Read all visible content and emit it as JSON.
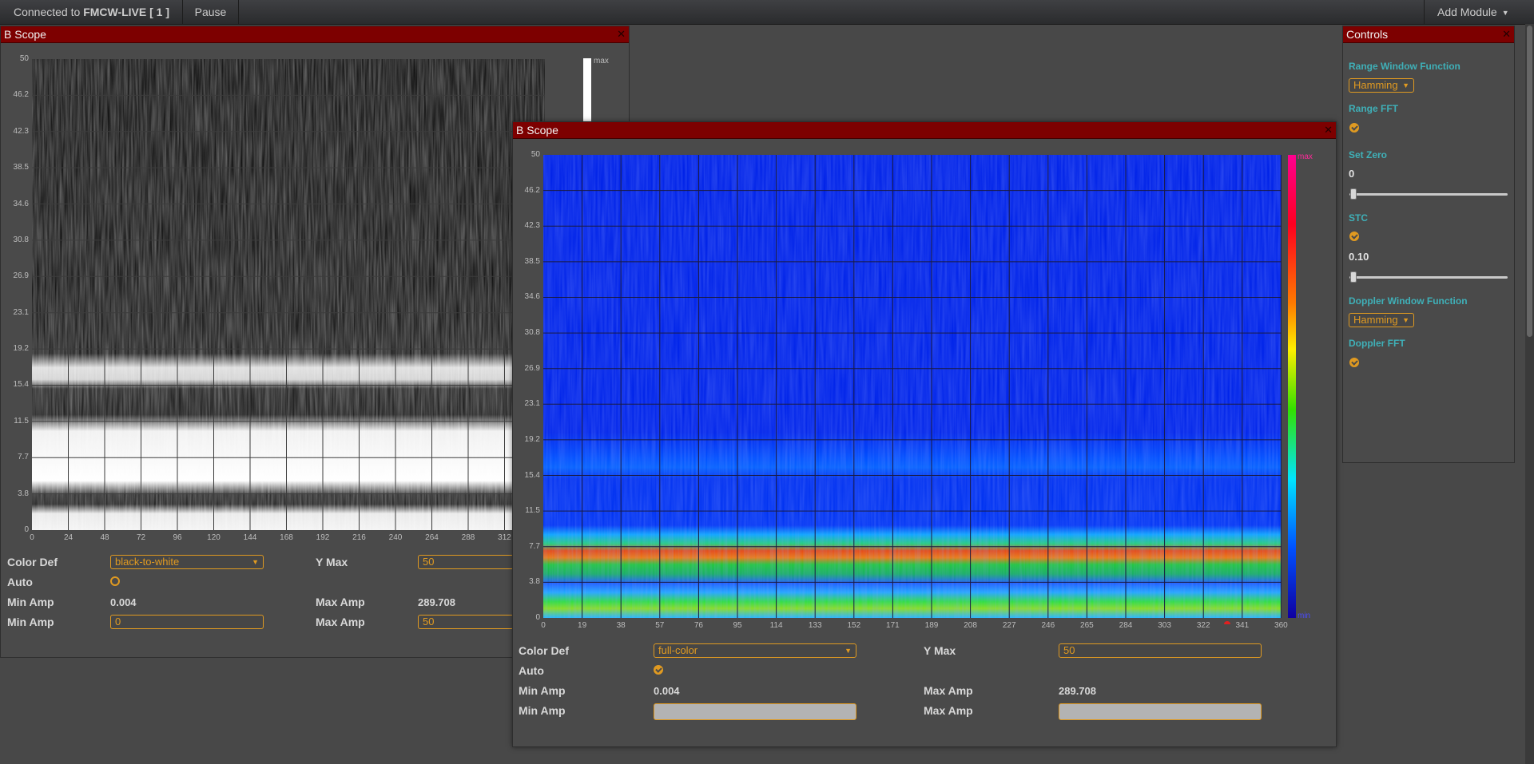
{
  "navbar": {
    "connected_prefix": "Connected to",
    "connected_name": "FMCW-LIVE [ 1 ]",
    "pause_label": "Pause",
    "add_module_label": "Add Module"
  },
  "scope1": {
    "title": "B Scope",
    "y_ticks": [
      "50",
      "46.2",
      "42.3",
      "38.5",
      "34.6",
      "30.8",
      "26.9",
      "23.1",
      "19.2",
      "15.4",
      "11.5",
      "7.7",
      "3.8",
      "0"
    ],
    "x_ticks": [
      "0",
      "24",
      "48",
      "72",
      "96",
      "120",
      "144",
      "168",
      "192",
      "216",
      "240",
      "264",
      "288",
      "312"
    ],
    "colorbar_max": "max",
    "color_def_label": "Color Def",
    "color_def_value": "black-to-white",
    "y_max_label": "Y Max",
    "y_max_value": "50",
    "auto_label": "Auto",
    "min_amp_label": "Min Amp",
    "min_amp_value": "0.004",
    "max_amp_label": "Max Amp",
    "max_amp_value": "289.708",
    "min_amp_input": "0",
    "max_amp_input": "50"
  },
  "scope2": {
    "title": "B Scope",
    "y_ticks": [
      "50",
      "46.2",
      "42.3",
      "38.5",
      "34.6",
      "30.8",
      "26.9",
      "23.1",
      "19.2",
      "15.4",
      "11.5",
      "7.7",
      "3.8",
      "0"
    ],
    "x_ticks": [
      "0",
      "19",
      "38",
      "57",
      "76",
      "95",
      "114",
      "133",
      "152",
      "171",
      "189",
      "208",
      "227",
      "246",
      "265",
      "284",
      "303",
      "322",
      "341",
      "360"
    ],
    "colorbar_max": "max",
    "colorbar_min": "min",
    "color_def_label": "Color Def",
    "color_def_value": "full-color",
    "y_max_label": "Y Max",
    "y_max_value": "50",
    "auto_label": "Auto",
    "min_amp_label": "Min Amp",
    "min_amp_value": "0.004",
    "max_amp_label": "Max Amp",
    "max_amp_value": "289.708",
    "min_amp2_label": "Min Amp",
    "max_amp2_label": "Max Amp"
  },
  "controls": {
    "title": "Controls",
    "range_window_label": "Range Window Function",
    "range_window_value": "Hamming",
    "range_fft_label": "Range FFT",
    "set_zero_label": "Set Zero",
    "set_zero_value": "0",
    "stc_label": "STC",
    "stc_value": "0.10",
    "doppler_window_label": "Doppler Window Function",
    "doppler_window_value": "Hamming",
    "doppler_fft_label": "Doppler FFT"
  },
  "colors": {
    "title_bar": "#7d0000",
    "accent": "#e09a21",
    "control_heading": "#3fb0b8"
  }
}
